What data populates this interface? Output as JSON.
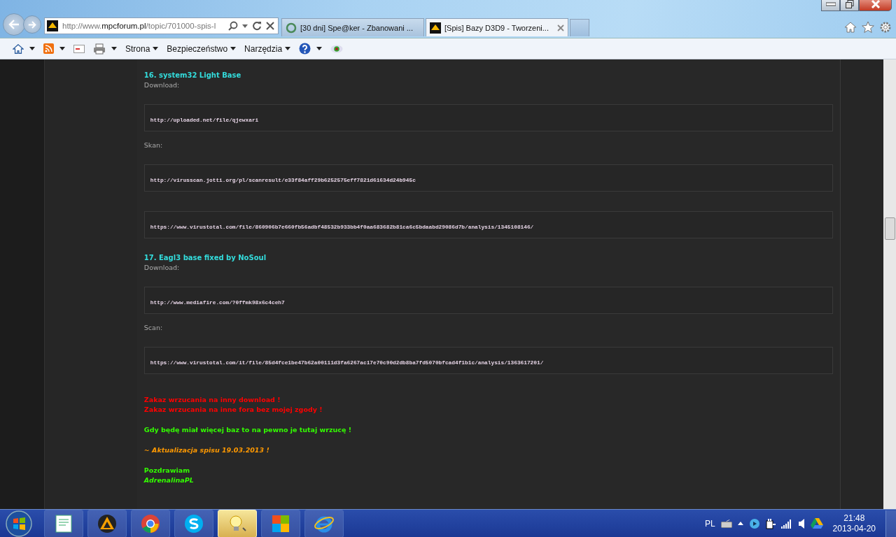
{
  "browser": {
    "address": {
      "prefix": "http://www.",
      "domain": "mpcforum.pl",
      "path": "/topic/701000-spis-l"
    },
    "tabs": [
      {
        "title": "[30 dni] Spe@ker - Zbanowani ...",
        "selected": false
      },
      {
        "title": "[Spis] Bazy D3D9 - Tworzeni...",
        "selected": true
      }
    ],
    "command_bar": [
      "Strona",
      "Bezpieczeństwo",
      "Narzędzia"
    ]
  },
  "post": [
    {
      "kind": "heading",
      "text": "16. system32 Light Base"
    },
    {
      "kind": "label",
      "text": "Download:"
    },
    {
      "kind": "code",
      "text": "http://uploaded.net/file/qjewxari"
    },
    {
      "kind": "label",
      "text": "Skan:"
    },
    {
      "kind": "code",
      "text": "http://virusscan.jotti.org/pl/scanresult/e33f84aff29b6252575eff7821d61634d24b945c"
    },
    {
      "kind": "code",
      "text": "https://www.virustotal.com/file/860906b7e660fb56adbf48532b933bb4f0aa683682b81ca6c5bdaabd29086d7b/analysis/1345108146/"
    },
    {
      "kind": "heading",
      "text": "17. Eagl3 base fixed by NoSoul"
    },
    {
      "kind": "label",
      "text": "Download:"
    },
    {
      "kind": "code",
      "text": "http://www.mediafire.com/?0ffmk98x6c4ceh7"
    },
    {
      "kind": "label",
      "text": "Scan:"
    },
    {
      "kind": "code",
      "text": "https://www.virustotal.com/it/file/85d4fce1be47b62a00111d3fa6267ac17e70c90d2db8ba7fd5070bfcad4f1b1c/analysis/1363617201/"
    }
  ],
  "notes": [
    [
      {
        "text": "Zakaz wrzucania na inny download !",
        "color": "#ff0000",
        "italic": false
      },
      {
        "text": "Zakaz wrzucania na inne fora bez mojej zgody !",
        "color": "#ff0000",
        "italic": false
      }
    ],
    [
      {
        "text": "Gdy będę miał więcej baz to na pewno je tutaj wrzucę !",
        "color": "#33ff00",
        "italic": false
      }
    ],
    [
      {
        "text": "~ Aktualizacja spisu 19.03.2013 !",
        "color": "#ff9900",
        "italic": true
      }
    ],
    [
      {
        "text": "Pozdrawiam",
        "color": "#33ff00",
        "italic": false
      },
      {
        "text": "AdrenalinaPL",
        "color": "#33ff00",
        "italic": true
      }
    ]
  ],
  "taskbar": {
    "apps": [
      {
        "kind": "notes",
        "active": false
      },
      {
        "kind": "cone",
        "active": false
      },
      {
        "kind": "chrome",
        "active": false
      },
      {
        "kind": "skype",
        "active": false
      },
      {
        "kind": "bulb",
        "active": true
      },
      {
        "kind": "tiles",
        "active": false
      },
      {
        "kind": "ie",
        "active": false
      }
    ],
    "tray": {
      "language": "PL",
      "time": "21:48",
      "date": "2013-04-20"
    }
  }
}
